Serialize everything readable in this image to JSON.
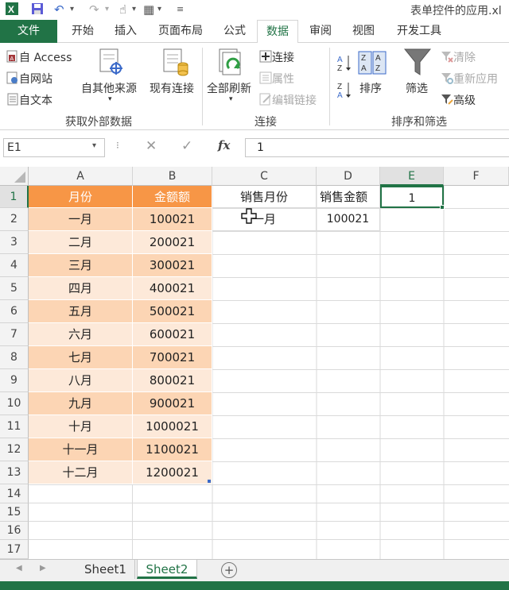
{
  "title": "表单控件的应用.xl",
  "tabs": [
    "文件",
    "开始",
    "插入",
    "页面布局",
    "公式",
    "数据",
    "审阅",
    "视图",
    "开发工具"
  ],
  "ribbon": {
    "get_external": {
      "access": "自 Access",
      "web": "自网站",
      "text": "自文本",
      "other": "自其他来源",
      "existing": "现有连接",
      "label": "获取外部数据"
    },
    "connections": {
      "refresh_all": "全部刷新",
      "connections": "连接",
      "properties": "属性",
      "edit_links": "编辑链接",
      "label": "连接"
    },
    "sort_filter": {
      "sort": "排序",
      "filter": "筛选",
      "clear": "清除",
      "reapply": "重新应用",
      "advanced": "高级",
      "label": "排序和筛选"
    }
  },
  "formula": {
    "name_box": "E1",
    "fx": "fx",
    "value": "1"
  },
  "columns": [
    "A",
    "B",
    "C",
    "D",
    "E",
    "F"
  ],
  "rows": [
    "1",
    "2",
    "3",
    "4",
    "5",
    "6",
    "7",
    "8",
    "9",
    "10",
    "11",
    "12",
    "13",
    "14",
    "15",
    "16",
    "17"
  ],
  "table": {
    "headers": [
      "月份",
      "金额额"
    ],
    "data": [
      [
        "一月",
        "100021"
      ],
      [
        "二月",
        "200021"
      ],
      [
        "三月",
        "300021"
      ],
      [
        "四月",
        "400021"
      ],
      [
        "五月",
        "500021"
      ],
      [
        "六月",
        "600021"
      ],
      [
        "七月",
        "700021"
      ],
      [
        "八月",
        "800021"
      ],
      [
        "九月",
        "900021"
      ],
      [
        "十月",
        "1000021"
      ],
      [
        "十一月",
        "1100021"
      ],
      [
        "十二月",
        "1200021"
      ]
    ]
  },
  "lookup": {
    "month_header": "销售月份",
    "amount_header": "销售金额",
    "month_value": "一月",
    "amount_value": "100021"
  },
  "e1_value": "1",
  "sheets": [
    "Sheet1",
    "Sheet2"
  ],
  "colors": {
    "accent": "#217346",
    "header_orange": "#f79646",
    "band_dark": "#fcd5b4",
    "band_light": "#fde9d9"
  }
}
